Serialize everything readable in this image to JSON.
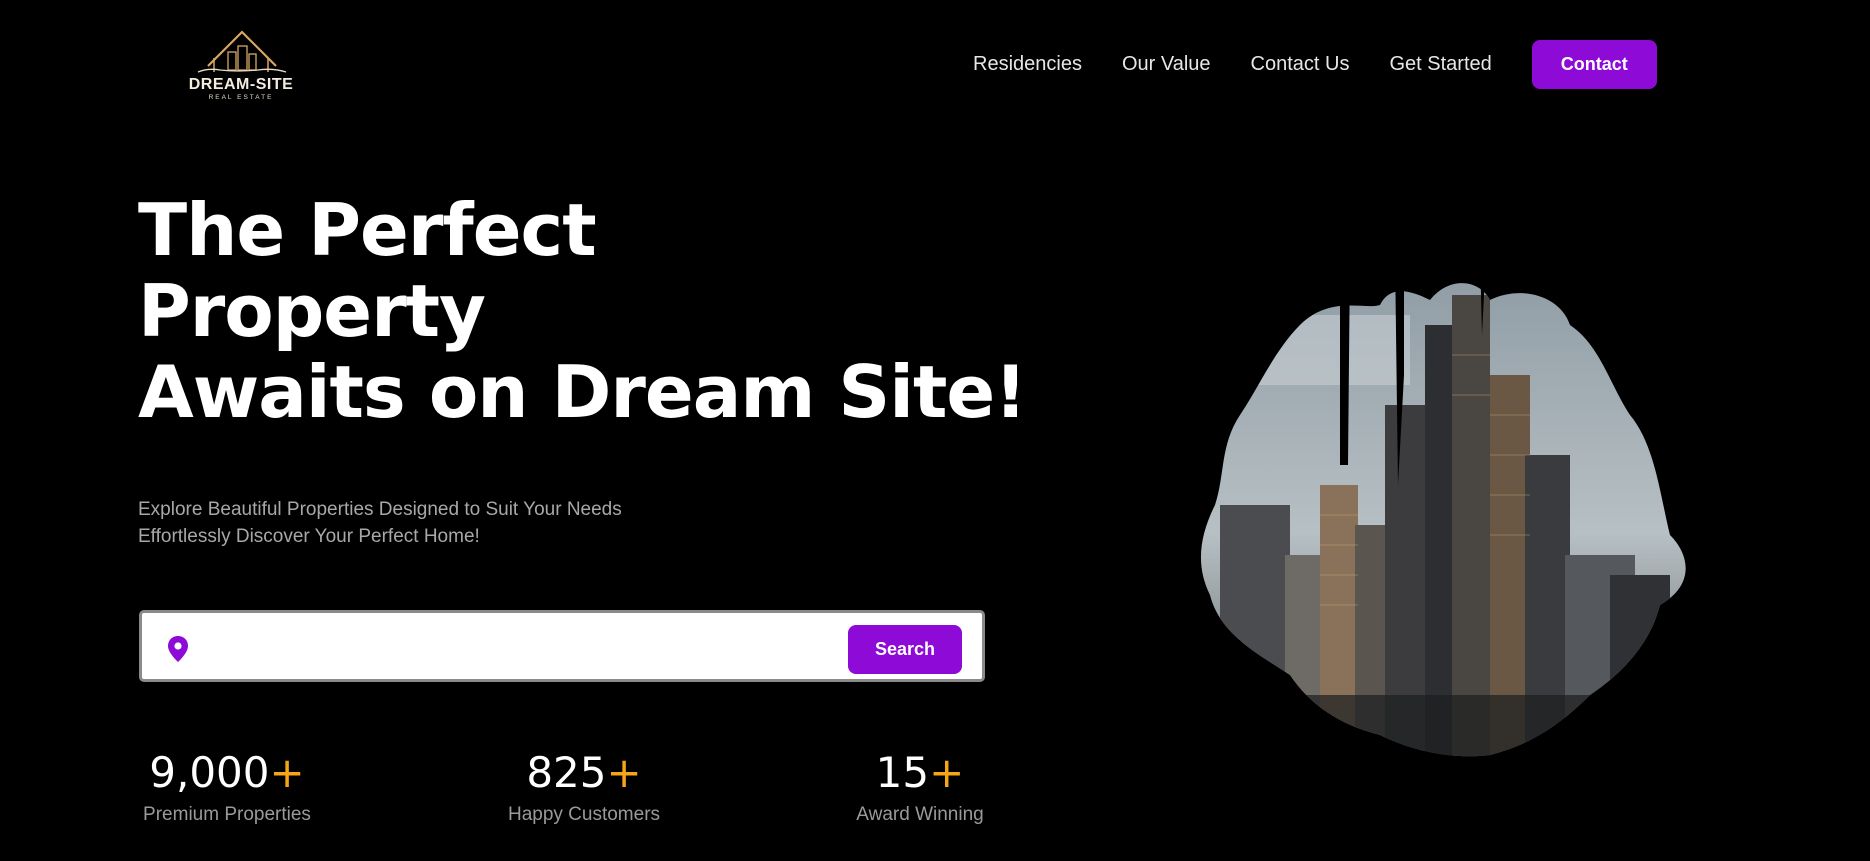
{
  "brand": {
    "name": "DREAM-SITE",
    "tagline": "REAL ESTATE"
  },
  "nav": {
    "links": [
      "Residencies",
      "Our Value",
      "Contact Us",
      "Get Started"
    ],
    "contact_button": "Contact"
  },
  "hero": {
    "title_lines": [
      "The Perfect",
      "Property",
      "Awaits on Dream Site!"
    ],
    "subtitle_lines": [
      "Explore Beautiful Properties Designed to Suit Your Needs",
      "Effortlessly Discover Your Perfect Home!"
    ]
  },
  "search": {
    "value": "",
    "placeholder": "",
    "button_label": "Search",
    "icon": "location-pin-icon"
  },
  "stats": [
    {
      "value": "9,000",
      "plus": "+",
      "label": "Premium Properties"
    },
    {
      "value": "825",
      "plus": "+",
      "label": "Happy Customers"
    },
    {
      "value": "15",
      "plus": "+",
      "label": "Award Winning"
    }
  ],
  "colors": {
    "accent": "#8e0ad6",
    "highlight": "#f7a516",
    "background": "#000000"
  }
}
